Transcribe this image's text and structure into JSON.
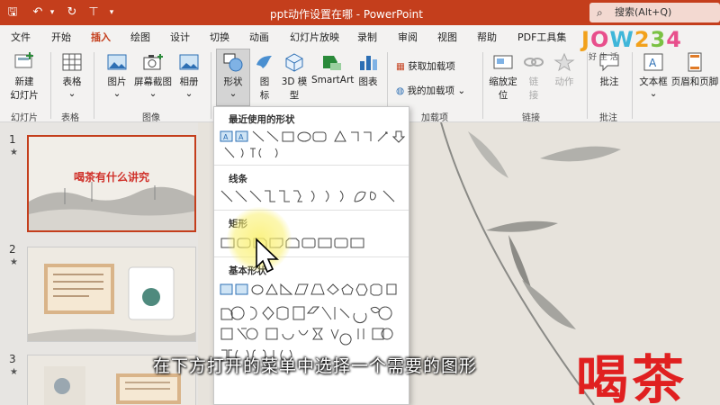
{
  "window": {
    "title": "ppt动作设置在哪  -  PowerPoint",
    "search_label": "搜索(Alt+Q)",
    "accent": "#c43e1c"
  },
  "tabs": [
    "文件",
    "开始",
    "插入",
    "绘图",
    "设计",
    "切换",
    "动画",
    "幻灯片放映",
    "录制",
    "审阅",
    "视图",
    "帮助",
    "PDF工具集"
  ],
  "active_tab": "插入",
  "ribbon": {
    "new_slide": "新建",
    "new_slide_sub": "幻灯片",
    "table": "表格",
    "picture": "图片",
    "screenshot": "屏幕截图",
    "album": "相册",
    "shapes": "形状",
    "icons": "图",
    "icons_sub": "标",
    "model_3d": "3D 模",
    "model_3d_sub": "型",
    "smartart": "SmartArt",
    "chart": "图表",
    "get_addins": "获取加载项",
    "my_addins": "我的加载项",
    "zoom": "缩放定",
    "zoom_sub": "位",
    "link": "链",
    "link_sub": "接",
    "action": "动作",
    "comment": "批注",
    "textbox": "文本框",
    "header_footer": "页眉和页脚",
    "groups": {
      "slides": "幻灯片",
      "tables": "表格",
      "images": "图像",
      "addins": "加载项",
      "links": "链接",
      "comments": "批注"
    }
  },
  "logo": {
    "text": "JOW234",
    "sub": "好  生  活"
  },
  "slides": [
    {
      "num": "1",
      "title": "喝茶有什么讲究"
    },
    {
      "num": "2"
    },
    {
      "num": "3"
    }
  ],
  "dropdown": {
    "recent": "最近使用的形状",
    "lines": "线条",
    "rect": "矩形",
    "basic": "基本形状"
  },
  "canvas_text": "喝茶",
  "subtitle": "在下方打开的菜单中选择一个需要的图形"
}
